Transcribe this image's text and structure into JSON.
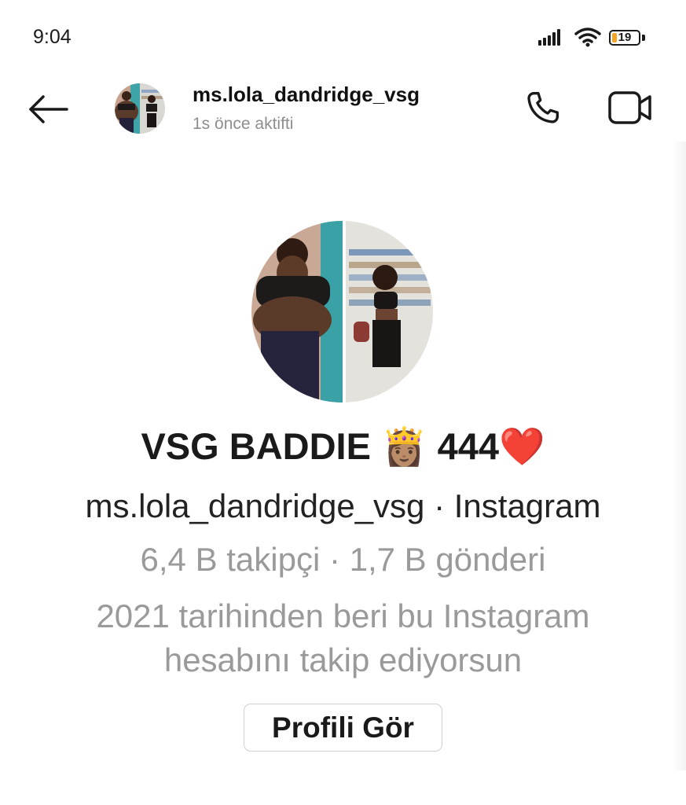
{
  "status_bar": {
    "time": "9:04",
    "battery_level": "19",
    "icons": [
      "signal-icon",
      "wifi-icon",
      "battery-icon"
    ]
  },
  "header": {
    "username": "ms.lola_dandridge_vsg",
    "active_status": "1s önce aktifti",
    "icons": [
      "back-arrow-icon",
      "phone-icon",
      "video-camera-icon"
    ]
  },
  "profile": {
    "display_name": "VSG BADDIE",
    "display_name_emoji": "👸🏽",
    "display_name_suffix": "444",
    "display_name_heart": "❤️",
    "handle_line": "ms.lola_dandridge_vsg · Instagram",
    "stats_line": "6,4 B takipçi · 1,7 B gönderi",
    "follow_note_line1": "2021 tarihinden beri bu Instagram",
    "follow_note_line2": "hesabını takip ediyorsun",
    "view_profile_label": "Profili Gör"
  },
  "colors": {
    "text_primary": "#1a1a1a",
    "text_secondary": "#9a9a9a",
    "battery_fill": "#f5a623",
    "heart": "#e5252b"
  }
}
